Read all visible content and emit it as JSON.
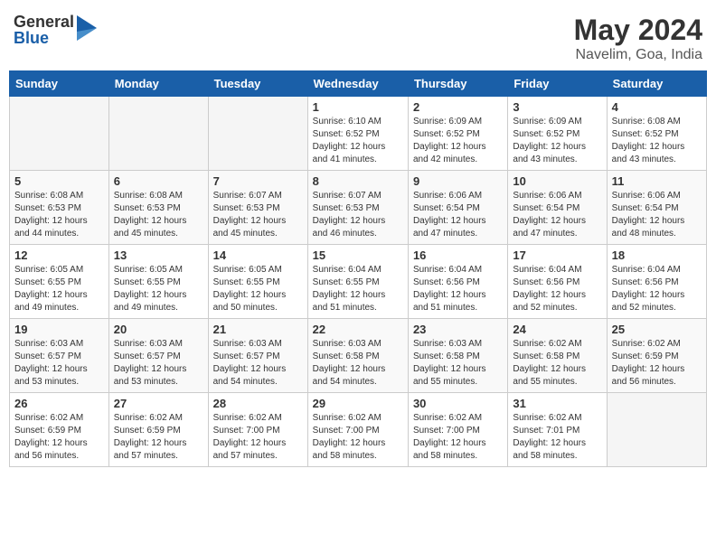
{
  "logo": {
    "general": "General",
    "blue": "Blue"
  },
  "title": "May 2024",
  "location": "Navelim, Goa, India",
  "headers": [
    "Sunday",
    "Monday",
    "Tuesday",
    "Wednesday",
    "Thursday",
    "Friday",
    "Saturday"
  ],
  "weeks": [
    [
      {
        "day": "",
        "info": ""
      },
      {
        "day": "",
        "info": ""
      },
      {
        "day": "",
        "info": ""
      },
      {
        "day": "1",
        "info": "Sunrise: 6:10 AM\nSunset: 6:52 PM\nDaylight: 12 hours\nand 41 minutes."
      },
      {
        "day": "2",
        "info": "Sunrise: 6:09 AM\nSunset: 6:52 PM\nDaylight: 12 hours\nand 42 minutes."
      },
      {
        "day": "3",
        "info": "Sunrise: 6:09 AM\nSunset: 6:52 PM\nDaylight: 12 hours\nand 43 minutes."
      },
      {
        "day": "4",
        "info": "Sunrise: 6:08 AM\nSunset: 6:52 PM\nDaylight: 12 hours\nand 43 minutes."
      }
    ],
    [
      {
        "day": "5",
        "info": "Sunrise: 6:08 AM\nSunset: 6:53 PM\nDaylight: 12 hours\nand 44 minutes."
      },
      {
        "day": "6",
        "info": "Sunrise: 6:08 AM\nSunset: 6:53 PM\nDaylight: 12 hours\nand 45 minutes."
      },
      {
        "day": "7",
        "info": "Sunrise: 6:07 AM\nSunset: 6:53 PM\nDaylight: 12 hours\nand 45 minutes."
      },
      {
        "day": "8",
        "info": "Sunrise: 6:07 AM\nSunset: 6:53 PM\nDaylight: 12 hours\nand 46 minutes."
      },
      {
        "day": "9",
        "info": "Sunrise: 6:06 AM\nSunset: 6:54 PM\nDaylight: 12 hours\nand 47 minutes."
      },
      {
        "day": "10",
        "info": "Sunrise: 6:06 AM\nSunset: 6:54 PM\nDaylight: 12 hours\nand 47 minutes."
      },
      {
        "day": "11",
        "info": "Sunrise: 6:06 AM\nSunset: 6:54 PM\nDaylight: 12 hours\nand 48 minutes."
      }
    ],
    [
      {
        "day": "12",
        "info": "Sunrise: 6:05 AM\nSunset: 6:55 PM\nDaylight: 12 hours\nand 49 minutes."
      },
      {
        "day": "13",
        "info": "Sunrise: 6:05 AM\nSunset: 6:55 PM\nDaylight: 12 hours\nand 49 minutes."
      },
      {
        "day": "14",
        "info": "Sunrise: 6:05 AM\nSunset: 6:55 PM\nDaylight: 12 hours\nand 50 minutes."
      },
      {
        "day": "15",
        "info": "Sunrise: 6:04 AM\nSunset: 6:55 PM\nDaylight: 12 hours\nand 51 minutes."
      },
      {
        "day": "16",
        "info": "Sunrise: 6:04 AM\nSunset: 6:56 PM\nDaylight: 12 hours\nand 51 minutes."
      },
      {
        "day": "17",
        "info": "Sunrise: 6:04 AM\nSunset: 6:56 PM\nDaylight: 12 hours\nand 52 minutes."
      },
      {
        "day": "18",
        "info": "Sunrise: 6:04 AM\nSunset: 6:56 PM\nDaylight: 12 hours\nand 52 minutes."
      }
    ],
    [
      {
        "day": "19",
        "info": "Sunrise: 6:03 AM\nSunset: 6:57 PM\nDaylight: 12 hours\nand 53 minutes."
      },
      {
        "day": "20",
        "info": "Sunrise: 6:03 AM\nSunset: 6:57 PM\nDaylight: 12 hours\nand 53 minutes."
      },
      {
        "day": "21",
        "info": "Sunrise: 6:03 AM\nSunset: 6:57 PM\nDaylight: 12 hours\nand 54 minutes."
      },
      {
        "day": "22",
        "info": "Sunrise: 6:03 AM\nSunset: 6:58 PM\nDaylight: 12 hours\nand 54 minutes."
      },
      {
        "day": "23",
        "info": "Sunrise: 6:03 AM\nSunset: 6:58 PM\nDaylight: 12 hours\nand 55 minutes."
      },
      {
        "day": "24",
        "info": "Sunrise: 6:02 AM\nSunset: 6:58 PM\nDaylight: 12 hours\nand 55 minutes."
      },
      {
        "day": "25",
        "info": "Sunrise: 6:02 AM\nSunset: 6:59 PM\nDaylight: 12 hours\nand 56 minutes."
      }
    ],
    [
      {
        "day": "26",
        "info": "Sunrise: 6:02 AM\nSunset: 6:59 PM\nDaylight: 12 hours\nand 56 minutes."
      },
      {
        "day": "27",
        "info": "Sunrise: 6:02 AM\nSunset: 6:59 PM\nDaylight: 12 hours\nand 57 minutes."
      },
      {
        "day": "28",
        "info": "Sunrise: 6:02 AM\nSunset: 7:00 PM\nDaylight: 12 hours\nand 57 minutes."
      },
      {
        "day": "29",
        "info": "Sunrise: 6:02 AM\nSunset: 7:00 PM\nDaylight: 12 hours\nand 58 minutes."
      },
      {
        "day": "30",
        "info": "Sunrise: 6:02 AM\nSunset: 7:00 PM\nDaylight: 12 hours\nand 58 minutes."
      },
      {
        "day": "31",
        "info": "Sunrise: 6:02 AM\nSunset: 7:01 PM\nDaylight: 12 hours\nand 58 minutes."
      },
      {
        "day": "",
        "info": ""
      }
    ]
  ]
}
